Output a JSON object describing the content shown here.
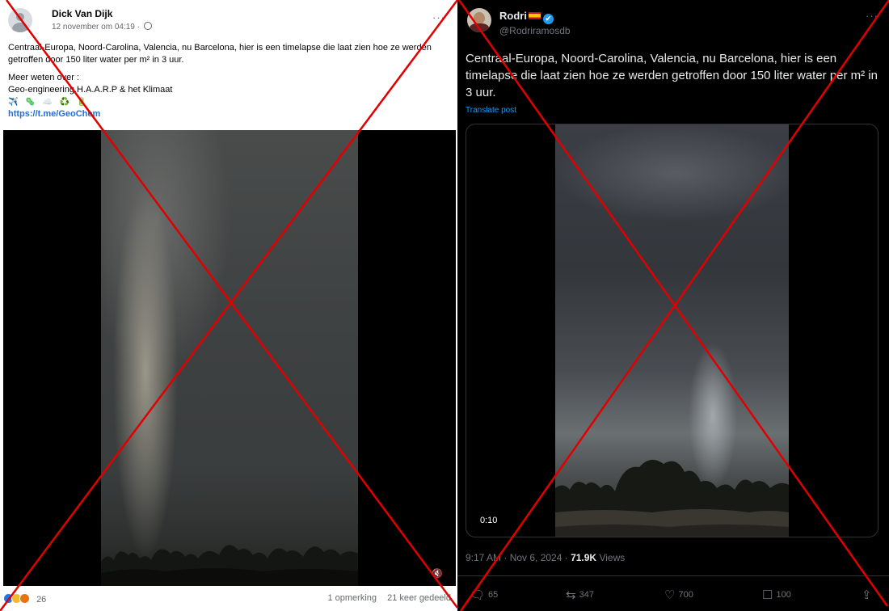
{
  "facebook": {
    "author": "Dick Van Dijk",
    "timestamp": "12 november om 04:19 ·",
    "more": "···",
    "text": "Centraal-Europa, Noord-Carolina, Valencia, nu Barcelona, hier is een timelapse die laat zien hoe ze werden getroffen door 150 liter water per m² in 3 uur.",
    "more_head": "Meer weten over :",
    "more_line": "Geo-engineering,H.A.A.R.P & het Klimaat",
    "emojis": "✈️ 🦠 ☁️ ♻️ 🔋",
    "link": "https://t.me/GeoChem",
    "mute_icon": "🔇",
    "reactions_count": "26",
    "comments": "1 opmerking",
    "shares": "21 keer gedeeld"
  },
  "twitter": {
    "name": "Rodri",
    "verified_mark": "✔",
    "handle": "@Rodriramosdb",
    "more": "···",
    "text": "Centraal-Europa, Noord-Carolina, Valencia, nu Barcelona, hier is een timelapse die laat zien hoe ze werden getroffen door 150 liter water per m² in 3 uur.",
    "translate": "Translate post",
    "video_time": "0:10",
    "posted": "9:17 AM · Nov 6, 2024 ·",
    "views_count": "71.9K",
    "views_label": "Views",
    "actions": {
      "reply_icon": "🗨",
      "replies": "65",
      "repost_icon": "⇆",
      "reposts": "347",
      "like_icon": "♡",
      "likes": "700",
      "bookmark_icon": "☐",
      "bookmarks": "100",
      "share_icon": "⇪"
    }
  },
  "overlay_color": "#e00000"
}
